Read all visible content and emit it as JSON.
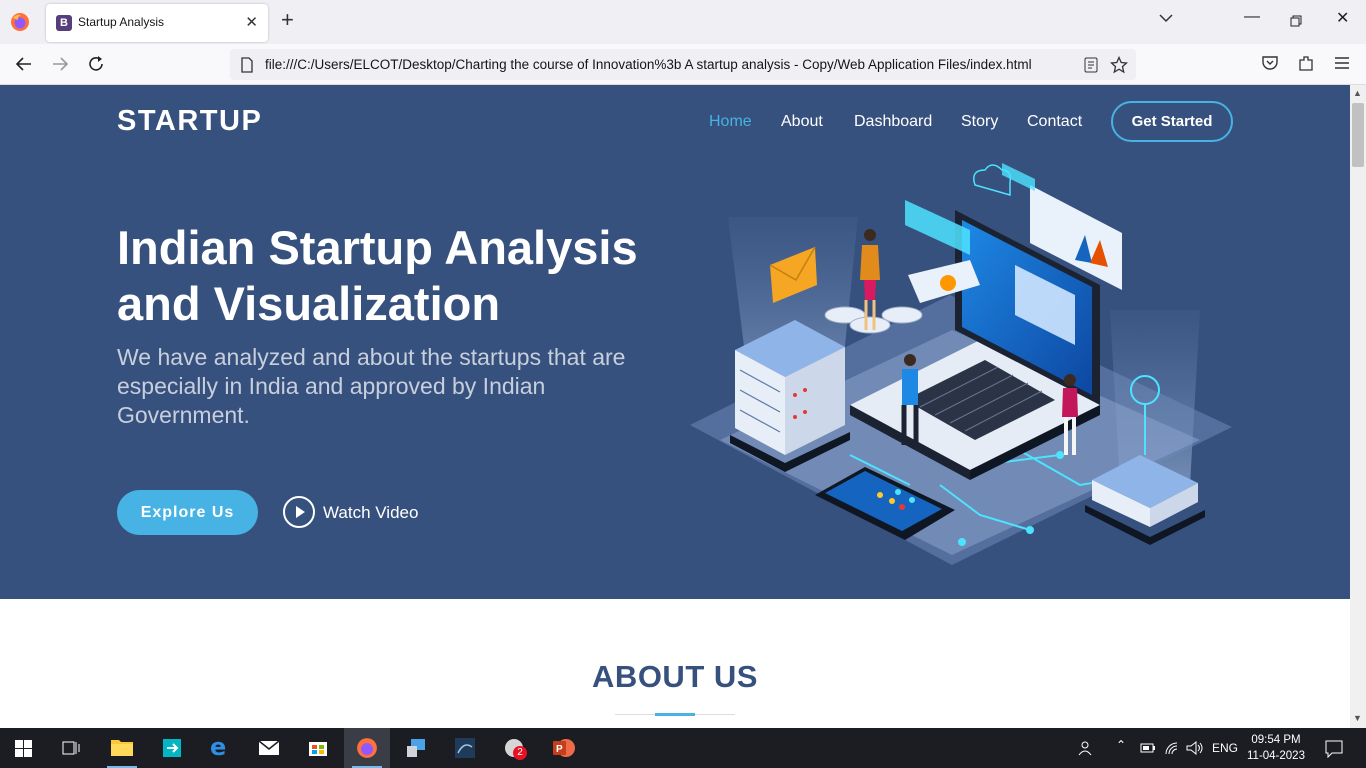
{
  "browser": {
    "tab_title": "Startup Analysis",
    "tab_favicon": "B",
    "url": "file:///C:/Users/ELCOT/Desktop/Charting the course of Innovation%3b A startup analysis - Copy/Web Application Files/index.html",
    "icons": [
      "firefox-icon",
      "close-icon",
      "plus-icon",
      "chevron-down-icon",
      "minimize-icon",
      "restore-icon",
      "back-icon",
      "forward-icon",
      "reload-icon",
      "page-icon",
      "reader-icon",
      "star-icon",
      "pocket-icon",
      "extensions-icon",
      "menu-icon"
    ]
  },
  "site": {
    "brand": "STARTUP",
    "nav": [
      {
        "label": "Home",
        "active": true
      },
      {
        "label": "About",
        "active": false
      },
      {
        "label": "Dashboard",
        "active": false
      },
      {
        "label": "Story",
        "active": false
      },
      {
        "label": "Contact",
        "active": false
      }
    ],
    "cta": "Get Started",
    "hero": {
      "title": "Indian Startup Analysis and Visualization",
      "subtitle": "We have analyzed and about the startups that are especially in India and approved by Indian Government.",
      "primary_button": "Explore Us",
      "secondary_button": "Watch Video"
    },
    "about_title": "ABOUT US",
    "colors": {
      "hero_bg": "#37517e",
      "accent": "#47b2e4"
    }
  },
  "taskbar": {
    "apps": [
      "start-icon",
      "task-view-icon",
      "file-explorer-icon",
      "edge-icon-legacy",
      "edge-icon",
      "mail-icon",
      "store-icon",
      "firefox-icon",
      "control-panel-icon",
      "mysql-workbench-icon",
      "chat-icon",
      "powerpoint-icon"
    ],
    "chat_badge": "2",
    "language": "ENG",
    "time": "09:54 PM",
    "date": "11-04-2023"
  }
}
